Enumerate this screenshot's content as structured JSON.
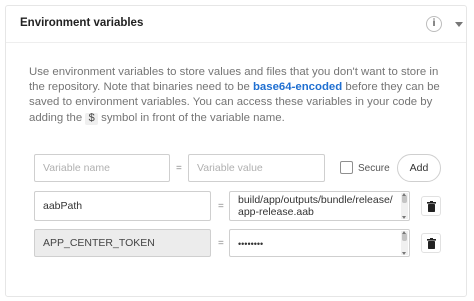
{
  "header": {
    "title": "Environment variables",
    "info_icon": "info-icon",
    "caret_icon": "caret-down-icon"
  },
  "description": {
    "part1": "Use environment variables to store values and files that you don't want to store in the repository. Note that binaries need to be ",
    "link": "base64-encoded",
    "part2": " before they can be saved to environment variables. You can access these variables in your code by adding the ",
    "code": "$",
    "part3": " symbol in front of the variable name."
  },
  "new_variable": {
    "name_placeholder": "Variable name",
    "value_placeholder": "Variable value",
    "equals": "=",
    "secure_label": "Secure",
    "secure_checked": false,
    "add_label": "Add"
  },
  "variables": [
    {
      "name": "aabPath",
      "value": "build/app/outputs/bundle/release/\napp-release.aab",
      "secure": false,
      "equals": "="
    },
    {
      "name": "APP_CENTER_TOKEN",
      "value": "••••••••",
      "secure": true,
      "equals": "="
    }
  ],
  "colors": {
    "link": "#1f6fd1",
    "border": "#cfcfcf",
    "muted_text": "#757575"
  }
}
